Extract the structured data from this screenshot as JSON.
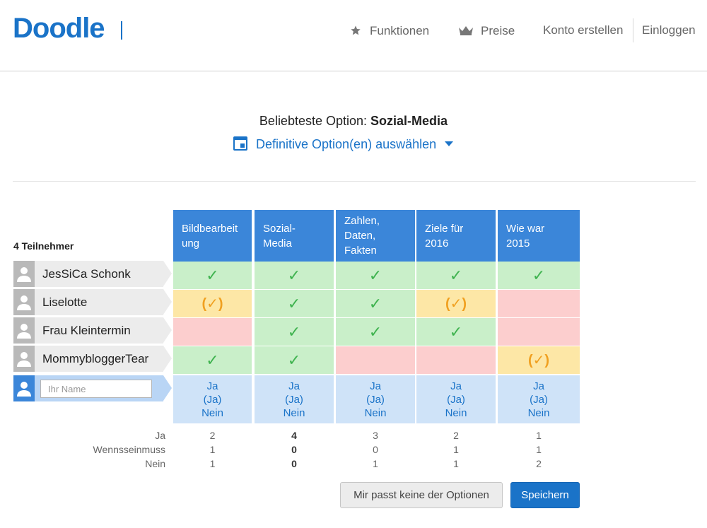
{
  "header": {
    "logo": "Doodle",
    "nav": [
      {
        "label": "Funktionen",
        "icon": "star-icon"
      },
      {
        "label": "Preise",
        "icon": "crown-icon"
      },
      {
        "label": "Konto erstellen"
      },
      {
        "label": "Einloggen"
      }
    ]
  },
  "summary": {
    "prefix": "Beliebteste Option: ",
    "best_option": "Sozial-Media",
    "definitive_label": "Definitive Option(en) auswählen"
  },
  "poll": {
    "participants_count_label": "4 Teilnehmer",
    "options": [
      {
        "label_lines": [
          "Bildbearbeit",
          "ung"
        ]
      },
      {
        "label_lines": [
          "Sozial-",
          "Media"
        ]
      },
      {
        "label_lines": [
          "Zahlen,",
          "Daten,",
          "Fakten"
        ]
      },
      {
        "label_lines": [
          "Ziele für",
          "2016"
        ]
      },
      {
        "label_lines": [
          "Wie war",
          "2015"
        ]
      }
    ],
    "participants": [
      {
        "name": "JesSiCa Schonk",
        "votes": [
          "yes",
          "yes",
          "yes",
          "yes",
          "yes"
        ]
      },
      {
        "name": "Liselotte",
        "votes": [
          "ifneedbe",
          "yes",
          "yes",
          "ifneedbe",
          "no"
        ]
      },
      {
        "name": "Frau Kleintermin",
        "votes": [
          "no",
          "yes",
          "yes",
          "yes",
          "no"
        ]
      },
      {
        "name": "MommybloggerTear",
        "votes": [
          "yes",
          "yes",
          "no",
          "no",
          "ifneedbe"
        ]
      }
    ],
    "symbols": {
      "yes": "✓",
      "ifneedbe": "(✓)"
    },
    "new_participant": {
      "placeholder": "Ihr Name",
      "choice_labels": [
        "Ja",
        "(Ja)",
        "Nein"
      ]
    },
    "count_labels": [
      "Ja",
      "Wennsseinmuss",
      "Nein"
    ],
    "counts": [
      [
        "2",
        "1",
        "1"
      ],
      [
        "4",
        "0",
        "0"
      ],
      [
        "3",
        "0",
        "1"
      ],
      [
        "2",
        "1",
        "1"
      ],
      [
        "1",
        "1",
        "2"
      ]
    ],
    "best_option_index": 1
  },
  "actions": {
    "none_label": "Mir passt keine der Optionen",
    "save_label": "Speichern"
  },
  "colors": {
    "brand": "#1a73c8",
    "header_blue": "#3b86d9",
    "yes": "#c9efc9",
    "ifneedbe": "#fde7a6",
    "no": "#fccece",
    "vote_row": "#cfe3f8"
  }
}
